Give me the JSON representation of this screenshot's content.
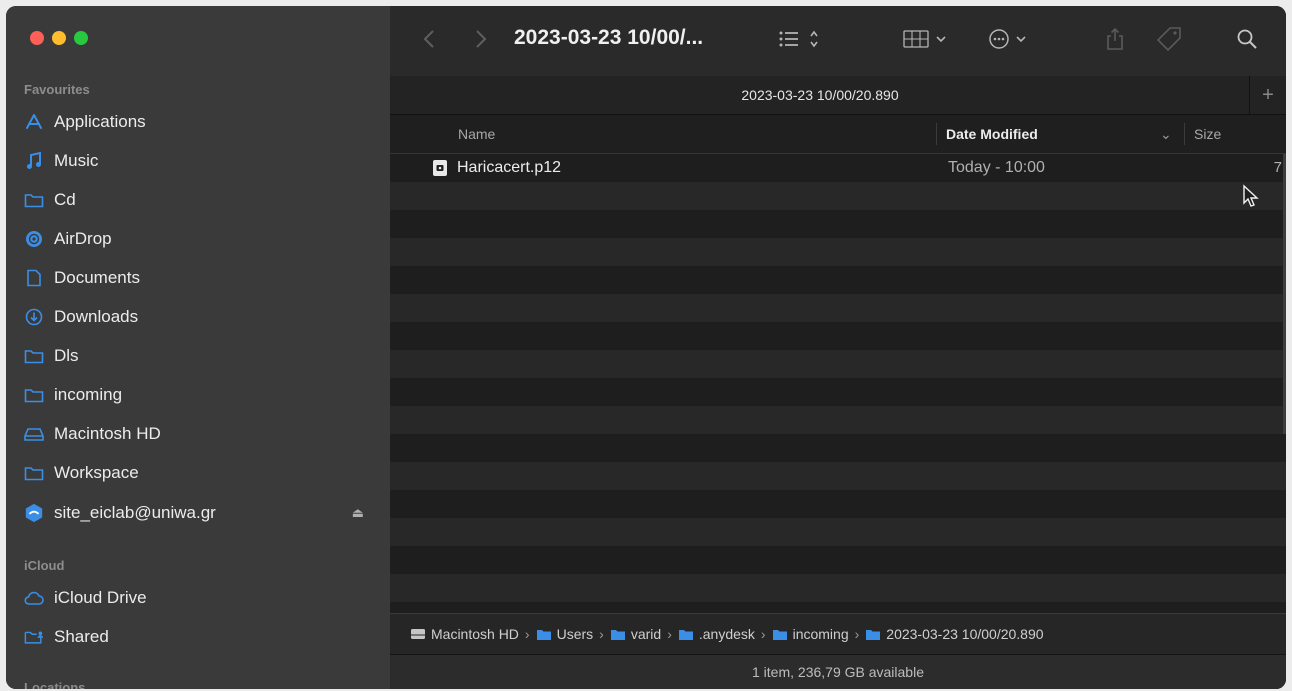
{
  "window": {
    "title": "2023-03-23 10/00/...",
    "tab_title": "2023-03-23 10/00/20.890"
  },
  "sidebar": {
    "favourites_label": "Favourites",
    "favourites": [
      {
        "label": "Applications",
        "icon": "applications-icon"
      },
      {
        "label": "Music",
        "icon": "music-icon"
      },
      {
        "label": "Cd",
        "icon": "folder-icon"
      },
      {
        "label": "AirDrop",
        "icon": "airdrop-icon"
      },
      {
        "label": "Documents",
        "icon": "document-icon"
      },
      {
        "label": "Downloads",
        "icon": "download-icon"
      },
      {
        "label": "Dls",
        "icon": "folder-icon"
      },
      {
        "label": "incoming",
        "icon": "folder-icon"
      },
      {
        "label": "Macintosh HD",
        "icon": "drive-icon"
      },
      {
        "label": "Workspace",
        "icon": "folder-icon"
      },
      {
        "label": "site_eiclab@uniwa.gr",
        "icon": "network-drive-icon"
      }
    ],
    "icloud_label": "iCloud",
    "icloud": [
      {
        "label": "iCloud Drive",
        "icon": "cloud-icon"
      },
      {
        "label": "Shared",
        "icon": "shared-folder-icon"
      }
    ],
    "locations_label": "Locations"
  },
  "columns": {
    "name": "Name",
    "date_modified": "Date Modified",
    "size": "Size"
  },
  "files": [
    {
      "name": "Haricacert.p12",
      "date": "Today - 10:00",
      "size": "7"
    }
  ],
  "path": [
    "Macintosh HD",
    "Users",
    "varid",
    ".anydesk",
    "incoming",
    "2023-03-23 10/00/20.890"
  ],
  "status": "1 item, 236,79 GB available",
  "colors": {
    "sidebar_bg": "#3a3a3a",
    "content_bg": "#1e1e1e",
    "accent_blue": "#3a8ee6"
  }
}
